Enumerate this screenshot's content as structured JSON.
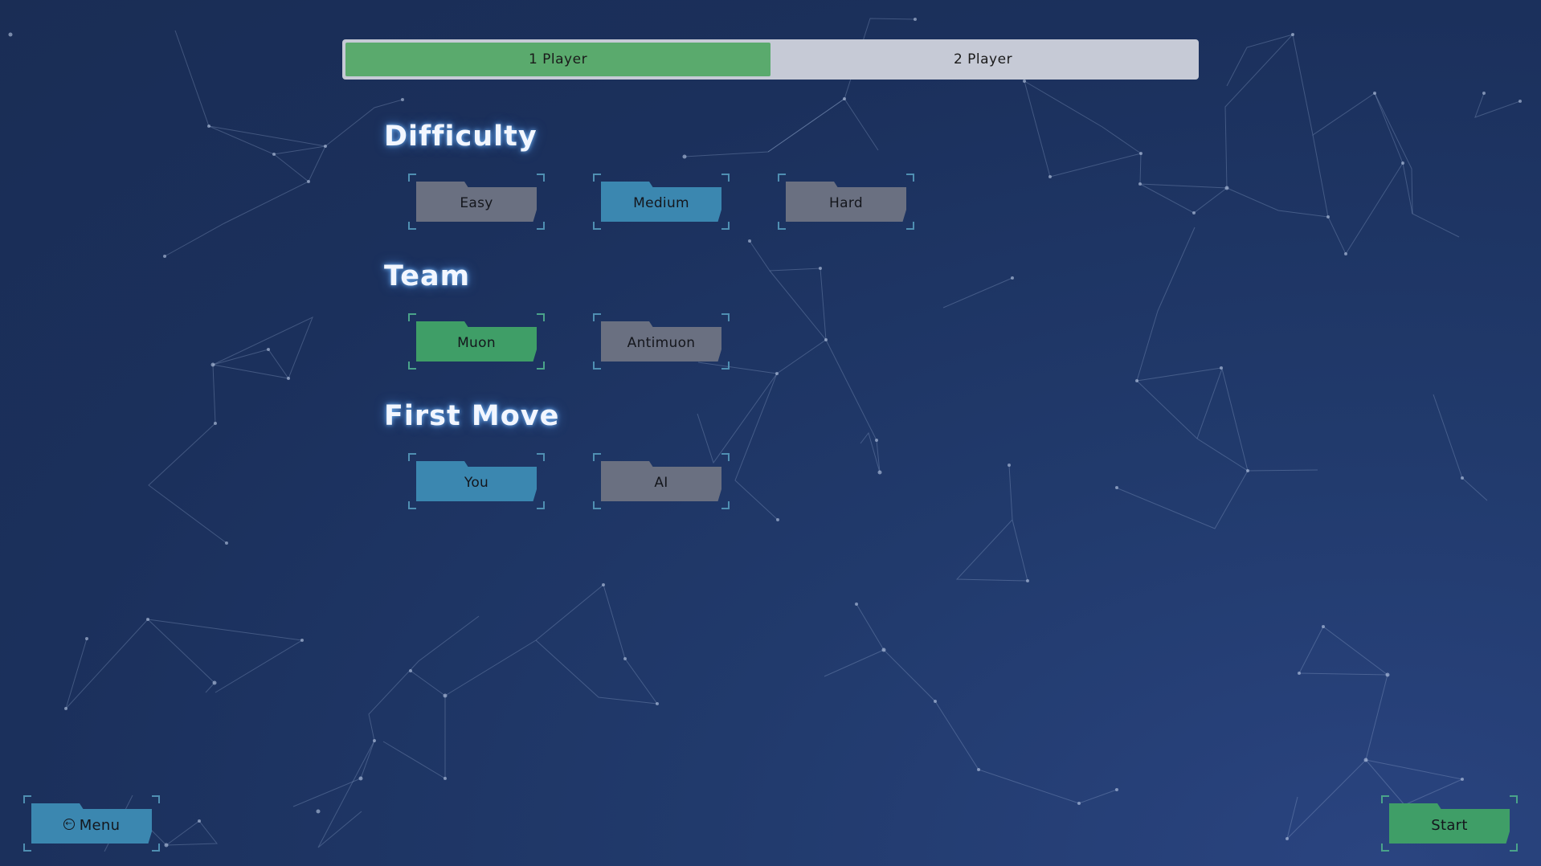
{
  "mode_tabs": [
    {
      "label": "1 Player",
      "active": true
    },
    {
      "label": "2 Player",
      "active": false
    }
  ],
  "sections": {
    "difficulty": {
      "title": "Difficulty",
      "options": [
        "Easy",
        "Medium",
        "Hard"
      ],
      "selected": "Medium"
    },
    "team": {
      "title": "Team",
      "options": [
        "Muon",
        "Antimuon"
      ],
      "selected": "Muon"
    },
    "first_move": {
      "title": "First Move",
      "options": [
        "You",
        "AI"
      ],
      "selected": "You"
    }
  },
  "footer": {
    "menu_label": "Menu",
    "menu_icon": "back-arrow-circle-icon",
    "start_label": "Start"
  },
  "colors": {
    "background": "#1b305c",
    "active_tab": "#5aaa6d",
    "tab_bar": "#c6cad6",
    "selected_blue": "#3b87b0",
    "selected_green": "#3f9e67",
    "unselected": "#6a7081"
  }
}
